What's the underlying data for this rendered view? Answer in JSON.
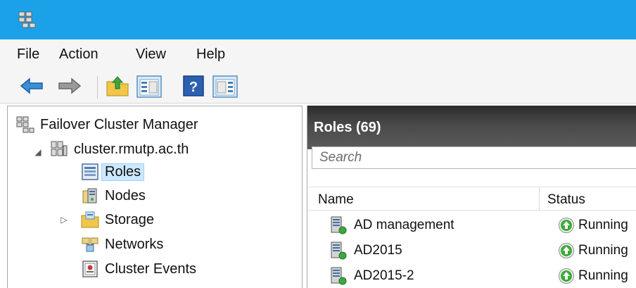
{
  "window": {
    "title": ""
  },
  "menu": {
    "items": [
      "File",
      "Action",
      "View",
      "Help"
    ]
  },
  "tree": {
    "root": "Failover Cluster Manager",
    "cluster": "cluster.rmutp.ac.th",
    "children": [
      "Roles",
      "Nodes",
      "Storage",
      "Networks",
      "Cluster Events"
    ],
    "selected": "Roles"
  },
  "roles": {
    "title": "Roles (69)",
    "search_placeholder": "Search",
    "columns": {
      "name": "Name",
      "status": "Status"
    },
    "rows": [
      {
        "name": "AD management",
        "status": "Running"
      },
      {
        "name": "AD2015",
        "status": "Running"
      },
      {
        "name": "AD2015-2",
        "status": "Running"
      }
    ]
  },
  "colors": {
    "titlebar": "#1aa1e8",
    "selection": "#cce8ff",
    "header_dark": "#3d3d3d",
    "status_running": "#3fa83a"
  },
  "icons": [
    "cluster-manager-icon",
    "back-arrow-icon",
    "forward-arrow-icon",
    "up-folder-icon",
    "show-tree-icon",
    "help-icon",
    "action-pane-icon",
    "role-server-icon",
    "running-status-icon"
  ]
}
